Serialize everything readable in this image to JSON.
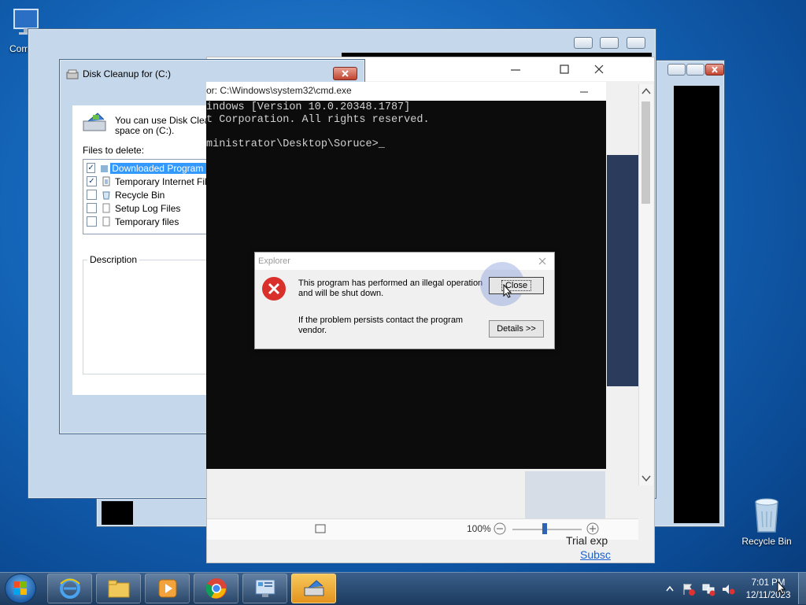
{
  "desktop": {
    "computer_label": "Com",
    "recycle_label": "Recycle Bin"
  },
  "disk_cleanup": {
    "title": "Disk Cleanup for  (C:)",
    "intro_line1": "You can use Disk Cleanu",
    "intro_line2": "space on  (C:).",
    "files_label": "Files to delete:",
    "items": [
      {
        "label": "Downloaded Program File",
        "checked": true
      },
      {
        "label": "Temporary Internet Files",
        "checked": true
      },
      {
        "label": "Recycle Bin",
        "checked": false
      },
      {
        "label": "Setup Log Files",
        "checked": false
      },
      {
        "label": "Temporary files",
        "checked": false
      }
    ],
    "description_label": "Description"
  },
  "cmd": {
    "title": "or: C:\\Windows\\system32\\cmd.exe",
    "line1": "indows [Version 10.0.20348.1787]",
    "line2": "t Corporation. All rights reserved.",
    "line3": "ministrator\\Desktop\\Soruce>"
  },
  "viewer": {
    "zoom": "100%",
    "trial_text": "Trial exp",
    "subscribe_text": "Subsc"
  },
  "error_dialog": {
    "title": "Explorer",
    "message_line1": "This program has performed an illegal operation",
    "message_line2": "and will be shut down.",
    "hint_line1": "If the problem persists contact the program",
    "hint_line2": "vendor.",
    "close_label": "Close",
    "details_label": "Details >>"
  },
  "taskbar": {
    "time": "7:01 PM",
    "date": "12/11/2023"
  },
  "colors": {
    "selection": "#3399ff",
    "error_red": "#d9302b",
    "taskbar": "#1c3a5e"
  }
}
